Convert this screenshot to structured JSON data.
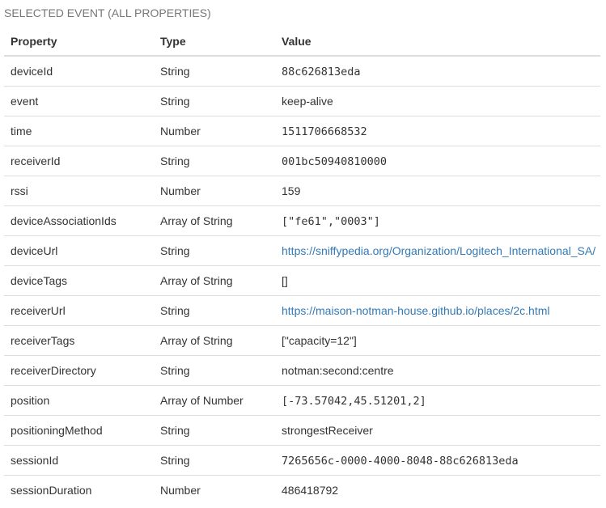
{
  "panel": {
    "title": "SELECTED EVENT (ALL PROPERTIES)"
  },
  "table": {
    "headers": {
      "property": "Property",
      "type": "Type",
      "value": "Value"
    },
    "rows": [
      {
        "property": "deviceId",
        "type": "String",
        "value": "88c626813eda",
        "style": "mono"
      },
      {
        "property": "event",
        "type": "String",
        "value": "keep-alive",
        "style": "text"
      },
      {
        "property": "time",
        "type": "Number",
        "value": "1511706668532",
        "style": "mono"
      },
      {
        "property": "receiverId",
        "type": "String",
        "value": "001bc50940810000",
        "style": "mono"
      },
      {
        "property": "rssi",
        "type": "Number",
        "value": "159",
        "style": "text"
      },
      {
        "property": "deviceAssociationIds",
        "type": "Array of String",
        "value": "[\"fe61\",\"0003\"]",
        "style": "mono"
      },
      {
        "property": "deviceUrl",
        "type": "String",
        "value": "https://sniffypedia.org/Organization/Logitech_International_SA/",
        "style": "link"
      },
      {
        "property": "deviceTags",
        "type": "Array of String",
        "value": "[]",
        "style": "text"
      },
      {
        "property": "receiverUrl",
        "type": "String",
        "value": "https://maison-notman-house.github.io/places/2c.html",
        "style": "link"
      },
      {
        "property": "receiverTags",
        "type": "Array of String",
        "value": "[\"capacity=12\"]",
        "style": "text"
      },
      {
        "property": "receiverDirectory",
        "type": "String",
        "value": "notman:second:centre",
        "style": "text"
      },
      {
        "property": "position",
        "type": "Array of Number",
        "value": "[-73.57042,45.51201,2]",
        "style": "mono"
      },
      {
        "property": "positioningMethod",
        "type": "String",
        "value": "strongestReceiver",
        "style": "text"
      },
      {
        "property": "sessionId",
        "type": "String",
        "value": "7265656c-0000-4000-8048-88c626813eda",
        "style": "mono"
      },
      {
        "property": "sessionDuration",
        "type": "Number",
        "value": "486418792",
        "style": "text"
      }
    ]
  }
}
